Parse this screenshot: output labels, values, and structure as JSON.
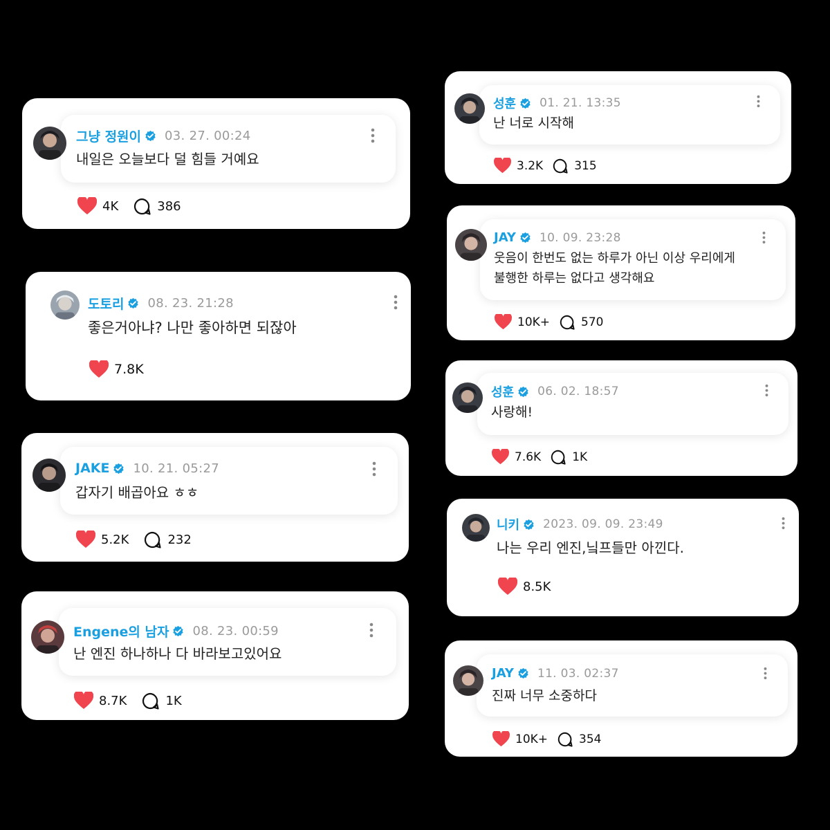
{
  "colors": {
    "name": "#1a9fe0",
    "heart": "#f0454f",
    "time": "#9a9a9a",
    "background": "#000000"
  },
  "icons": {
    "verified": "verified-badge-icon",
    "like": "heart-icon",
    "comment": "comment-bubble-icon",
    "more": "kebab-menu-icon"
  },
  "posts": [
    {
      "name": "그냥 정원이",
      "time": "03. 27. 00:24",
      "text": "내일은 오늘보다 덜 힘들 거예요",
      "likes": "4K",
      "comments": "386"
    },
    {
      "name": "도토리",
      "time": "08. 23. 21:28",
      "text": "좋은거아냐? 나만 좋아하면 되잖아",
      "likes": "7.8K"
    },
    {
      "name": "JAKE",
      "time": "10. 21. 05:27",
      "text": "갑자기 배곱아요 ㅎㅎ",
      "likes": "5.2K",
      "comments": "232"
    },
    {
      "name": "Engene의 남자",
      "time": "08. 23. 00:59",
      "text": "난 엔진 하나하나 다 바라보고있어요",
      "likes": "8.7K",
      "comments": "1K"
    },
    {
      "name": "성훈",
      "time": "01. 21. 13:35",
      "text": "난 너로 시작해",
      "likes": "3.2K",
      "comments": "315"
    },
    {
      "name": "JAY",
      "time": "10. 09. 23:28",
      "text": "웃음이 한번도 없는 하루가 아닌 이상 우리에게",
      "text2": "불행한 하루는 없다고 생각해요",
      "likes": "10K+",
      "comments": "570"
    },
    {
      "name": "성훈",
      "time": "06. 02. 18:57",
      "text": "사랑해!",
      "likes": "7.6K",
      "comments": "1K"
    },
    {
      "name": "니키",
      "time": "2023. 09. 09. 23:49",
      "text": "나는 우리 엔진,닠프들만 아낀다.",
      "likes": "8.5K"
    },
    {
      "name": "JAY",
      "time": "11. 03. 02:37",
      "text": "진짜 너무 소중하다",
      "likes": "10K+",
      "comments": "354"
    }
  ]
}
